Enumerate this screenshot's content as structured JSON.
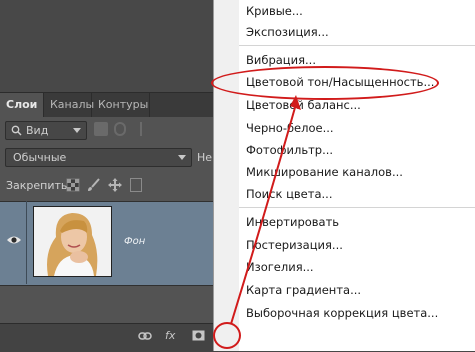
{
  "layers_panel": {
    "tabs": [
      "Слои",
      "Каналы",
      "Контуры"
    ],
    "filter": {
      "value": "Вид"
    },
    "blend_mode": {
      "value": "Обычные"
    },
    "opacity_label_partial": "Неп",
    "lock_label": "Закрепить:",
    "layer": {
      "name": "Фон"
    }
  },
  "menu": {
    "items_group1": [
      "Кривые...",
      "Экспозиция..."
    ],
    "items_group2": [
      "Вибрация...",
      "Цветовой тон/Насыщенность...",
      "Цветовой баланс...",
      "Черно-белое...",
      "Фотофильтр...",
      "Микширование каналов...",
      "Поиск цвета..."
    ],
    "items_group3": [
      "Инвертировать",
      "Постеризация...",
      "Изогелия...",
      "Карта градиента...",
      "Выборочная коррекция цвета..."
    ],
    "highlighted": "Цветовой тон/Насыщенность..."
  },
  "colors": {
    "annotation": "#d11b1b",
    "selected_layer": "#6c8093",
    "panel": "#535353"
  },
  "icons": [
    "search-icon",
    "eye-icon",
    "link-icon",
    "fx-icon",
    "mask-icon",
    "adjustment-layer-icon",
    "folder-icon",
    "new-layer-icon",
    "trash-icon",
    "lock-pixels-icon",
    "lock-brush-icon",
    "lock-move-icon"
  ]
}
